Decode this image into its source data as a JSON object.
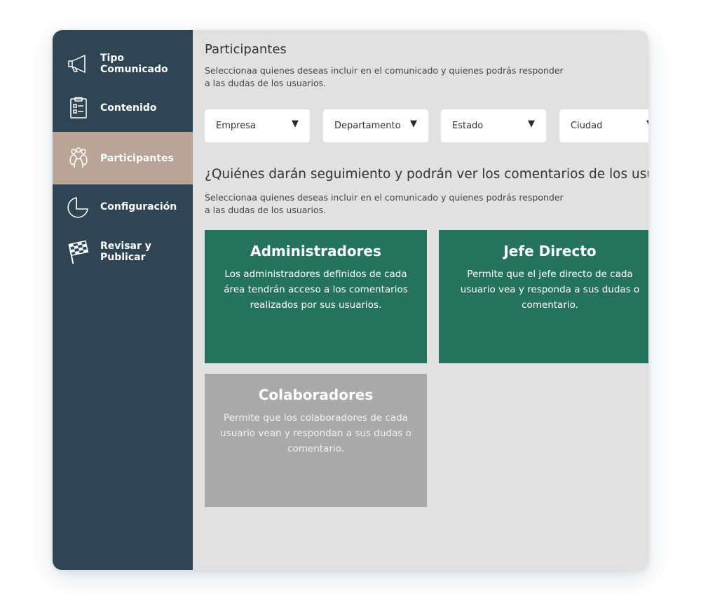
{
  "sidebar": {
    "items": [
      {
        "label": "Tipo\nComunicado",
        "icon": "megaphone-icon",
        "active": false
      },
      {
        "label": "Contenido",
        "icon": "clipboard-icon",
        "active": false
      },
      {
        "label": "Participantes",
        "icon": "users-icon",
        "active": true
      },
      {
        "label": "Configuración",
        "icon": "pie-chart-icon",
        "active": false
      },
      {
        "label": "Revisar y\nPublicar",
        "icon": "checkered-flag-icon",
        "active": false
      }
    ]
  },
  "main": {
    "title": "Participantes",
    "description": "Seleccionaa quienes deseas incluir en el comunicado y quienes podrás responder a las dudas de los usuarios.",
    "filters": [
      {
        "label": "Empresa",
        "arrow": "▼"
      },
      {
        "label": "Departamento",
        "arrow": "▼"
      },
      {
        "label": "Estado",
        "arrow": "▼"
      },
      {
        "label": "Ciudad",
        "arrow": "▼"
      }
    ],
    "section_title": "¿Quiénes darán seguimiento y podrán ver los comentarios de los usuarios?",
    "section_description": "Seleccionaa quienes deseas incluir en el comunicado y quienes podrás responder a las dudas de los usuarios.",
    "cards": [
      {
        "title": "Administradores",
        "text": "Los administradores definidos de cada área tendrán acceso a los comentarios realizados por sus usuarios.",
        "selected": true
      },
      {
        "title": "Jefe Directo",
        "text": "Permite que el jefe directo de cada usuario vea y responda a sus dudas o comentario.",
        "selected": true
      },
      {
        "title": "Colaboradores",
        "text": "Permite que los colaboradores de cada usuario vean y respondan a sus dudas o comentario.",
        "selected": false
      }
    ]
  },
  "colors": {
    "sidebar_bg": "#2f4553",
    "sidebar_active": "#b9a597",
    "content_bg": "#e1e1e1",
    "card_selected": "#25735d",
    "card_unselected": "#a9a9a9"
  }
}
